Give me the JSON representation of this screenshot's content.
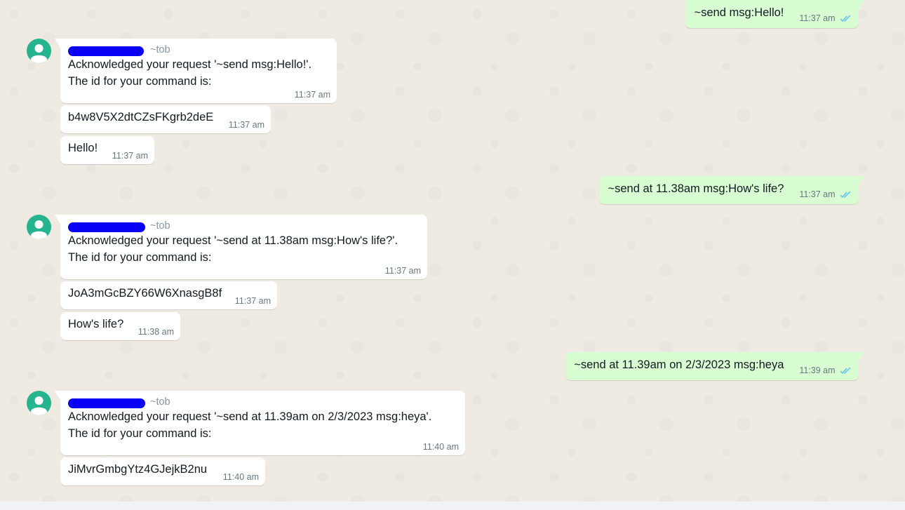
{
  "messages": [
    {
      "dir": "out",
      "text": "~send msg:Hello!",
      "time": "11:37 am",
      "read": true
    },
    {
      "dir": "in",
      "sender": "~tob",
      "text": "Acknowledged your request '~send msg:Hello!'.\nThe id for your command is:",
      "time": "11:37 am"
    },
    {
      "dir": "in",
      "text": "b4w8V5X2dtCZsFKgrb2deE",
      "time": "11:37 am"
    },
    {
      "dir": "in",
      "text": "Hello!",
      "time": "11:37 am"
    },
    {
      "dir": "out",
      "text": "~send at 11.38am msg:How's life?",
      "time": "11:37 am",
      "read": true
    },
    {
      "dir": "in",
      "sender": "~tob",
      "text": "Acknowledged your request '~send at 11.38am msg:How's life?'.\nThe id for your command is:",
      "time": "11:37 am"
    },
    {
      "dir": "in",
      "text": "JoA3mGcBZY66W6XnasgB8f",
      "time": "11:37 am"
    },
    {
      "dir": "in",
      "text": "How's life?",
      "time": "11:38 am"
    },
    {
      "dir": "out",
      "text": "~send at 11.39am on 2/3/2023 msg:heya",
      "time": "11:39 am",
      "read": true
    },
    {
      "dir": "in",
      "sender": "~tob",
      "text": "Acknowledged your request '~send at 11.39am on 2/3/2023 msg:heya'.\nThe id for your command is:",
      "time": "11:40 am"
    },
    {
      "dir": "in",
      "text": "JiMvrGmbgYtz4GJejkB2nu",
      "time": "11:40 am"
    }
  ],
  "icons": {
    "avatar": "default-user-avatar-icon",
    "read_receipt": "double-check-icon"
  },
  "colors": {
    "chat_background": "#efeae2",
    "incoming_bubble": "#ffffff",
    "outgoing_bubble": "#d9fdd3",
    "avatar": "#25b48d",
    "read_ticks": "#53bdeb",
    "redaction": "#0a00f5",
    "timestamp": "#667781"
  }
}
